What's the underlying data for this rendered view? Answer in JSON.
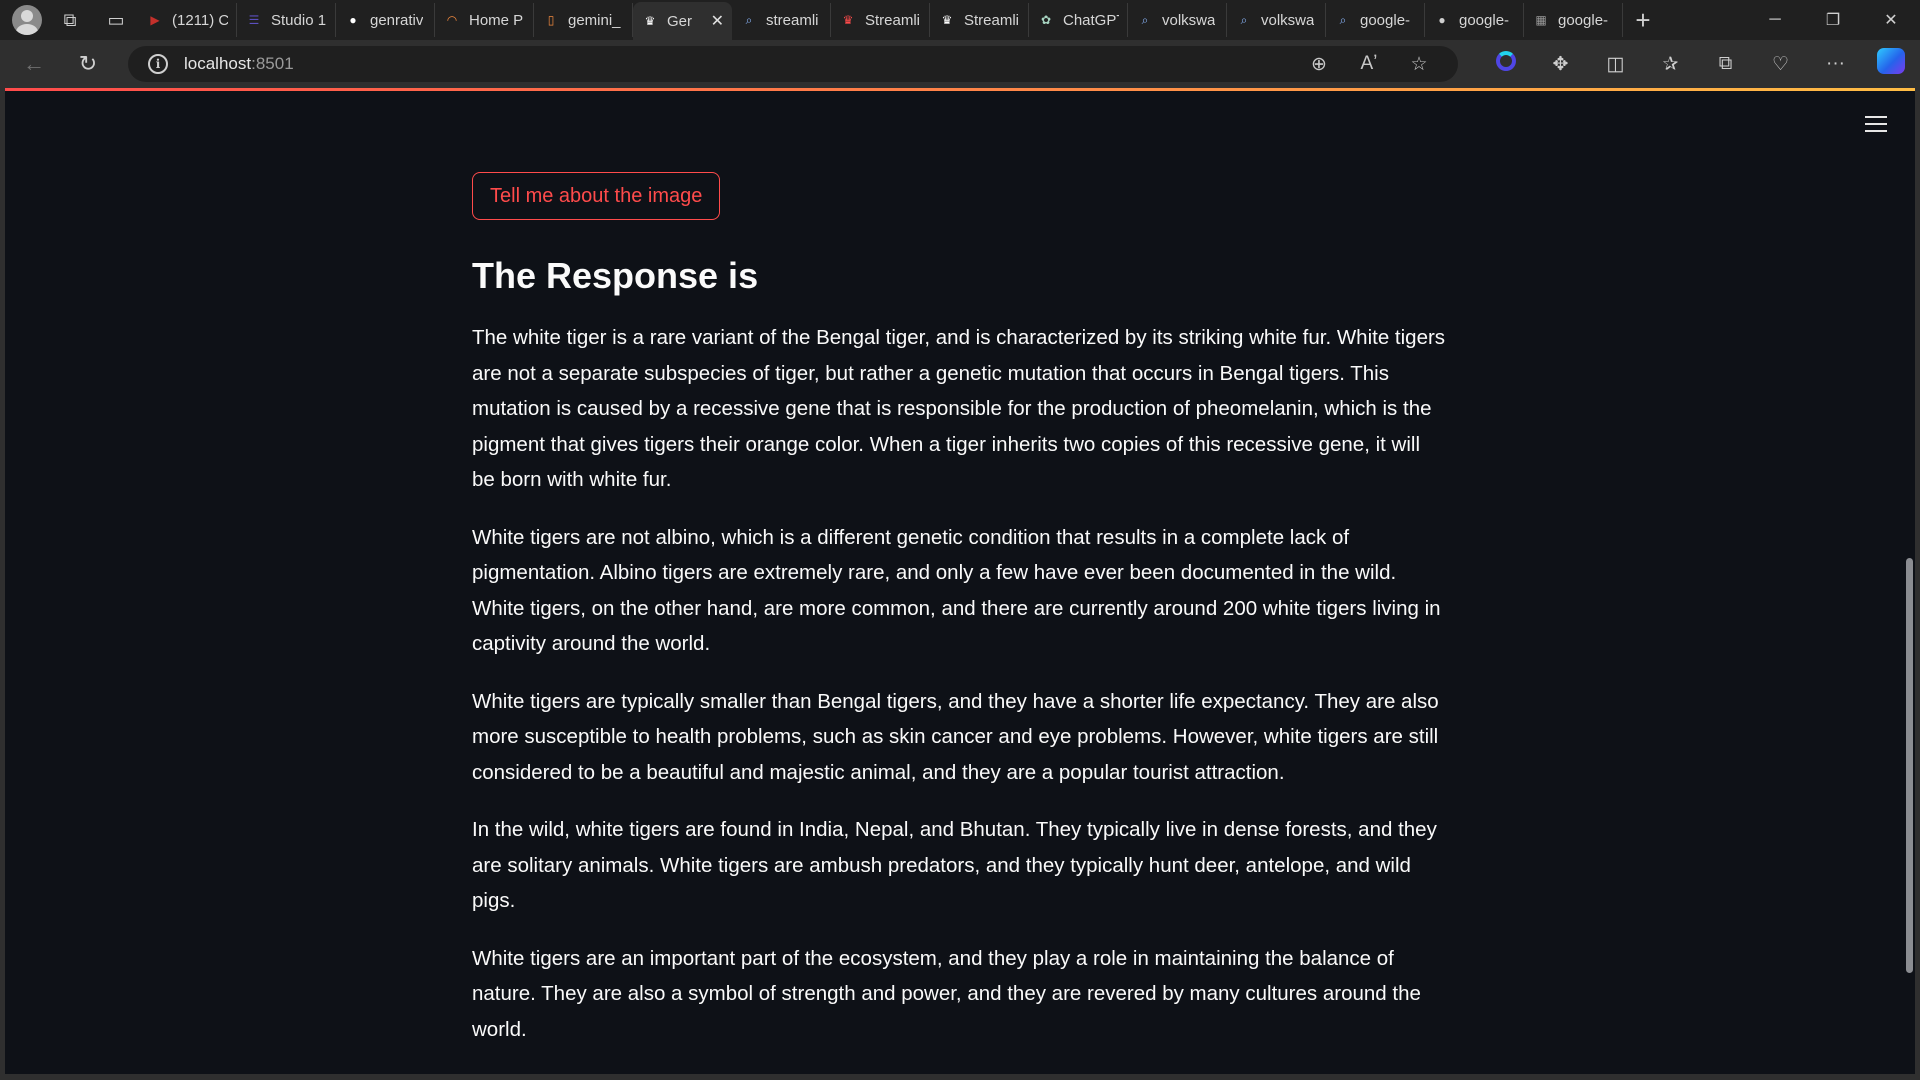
{
  "browser": {
    "tabs": [
      {
        "label": "(1211) C",
        "icon": "youtube-icon",
        "color": "#c4302b"
      },
      {
        "label": "Studio 1",
        "icon": "list-icon",
        "color": "#5b4fbf"
      },
      {
        "label": "genrativ",
        "icon": "github-icon",
        "color": "#ffffff"
      },
      {
        "label": "Home P",
        "icon": "loading-icon",
        "color": "#f0883e"
      },
      {
        "label": "gemini_",
        "icon": "document-icon",
        "color": "#f0883e"
      },
      {
        "label": "Ger",
        "icon": "streamlit-icon",
        "color": "#ffffff",
        "active": true
      },
      {
        "label": "streamli",
        "icon": "search-icon",
        "color": "#8ab4f8"
      },
      {
        "label": "Streamli",
        "icon": "streamlit-icon",
        "color": "#ff4b4b"
      },
      {
        "label": "Streamli",
        "icon": "streamlit-icon",
        "color": "#ffffff"
      },
      {
        "label": "ChatGPT",
        "icon": "chatgpt-icon",
        "color": "#a8d5c2"
      },
      {
        "label": "volkswa",
        "icon": "search-icon",
        "color": "#8ab4f8"
      },
      {
        "label": "volkswa",
        "icon": "search-icon",
        "color": "#8ab4f8"
      },
      {
        "label": "google-",
        "icon": "search-icon",
        "color": "#8ab4f8"
      },
      {
        "label": "google-",
        "icon": "github-icon",
        "color": "#cfcfcf"
      },
      {
        "label": "google-",
        "icon": "grid-icon",
        "color": "#9a9a9a"
      }
    ],
    "url_host": "localhost",
    "url_port": ":8501"
  },
  "app": {
    "button_label": "Tell me about the image",
    "heading": "The Response is",
    "paragraphs": [
      "The white tiger is a rare variant of the Bengal tiger, and is characterized by its striking white fur. White tigers are not a separate subspecies of tiger, but rather a genetic mutation that occurs in Bengal tigers. This mutation is caused by a recessive gene that is responsible for the production of pheomelanin, which is the pigment that gives tigers their orange color. When a tiger inherits two copies of this recessive gene, it will be born with white fur.",
      "White tigers are not albino, which is a different genetic condition that results in a complete lack of pigmentation. Albino tigers are extremely rare, and only a few have ever been documented in the wild. White tigers, on the other hand, are more common, and there are currently around 200 white tigers living in captivity around the world.",
      "White tigers are typically smaller than Bengal tigers, and they have a shorter life expectancy. They are also more susceptible to health problems, such as skin cancer and eye problems. However, white tigers are still considered to be a beautiful and majestic animal, and they are a popular tourist attraction.",
      "In the wild, white tigers are found in India, Nepal, and Bhutan. They typically live in dense forests, and they are solitary animals. White tigers are ambush predators, and they typically hunt deer, antelope, and wild pigs.",
      "White tigers are an important part of the ecosystem, and they play a role in maintaining the balance of nature. They are also a symbol of strength and power, and they are revered by many cultures around the world."
    ]
  },
  "colors": {
    "accent": "#ff4b4b",
    "page_bg": "#0e1117",
    "chrome_bg": "#202020"
  }
}
